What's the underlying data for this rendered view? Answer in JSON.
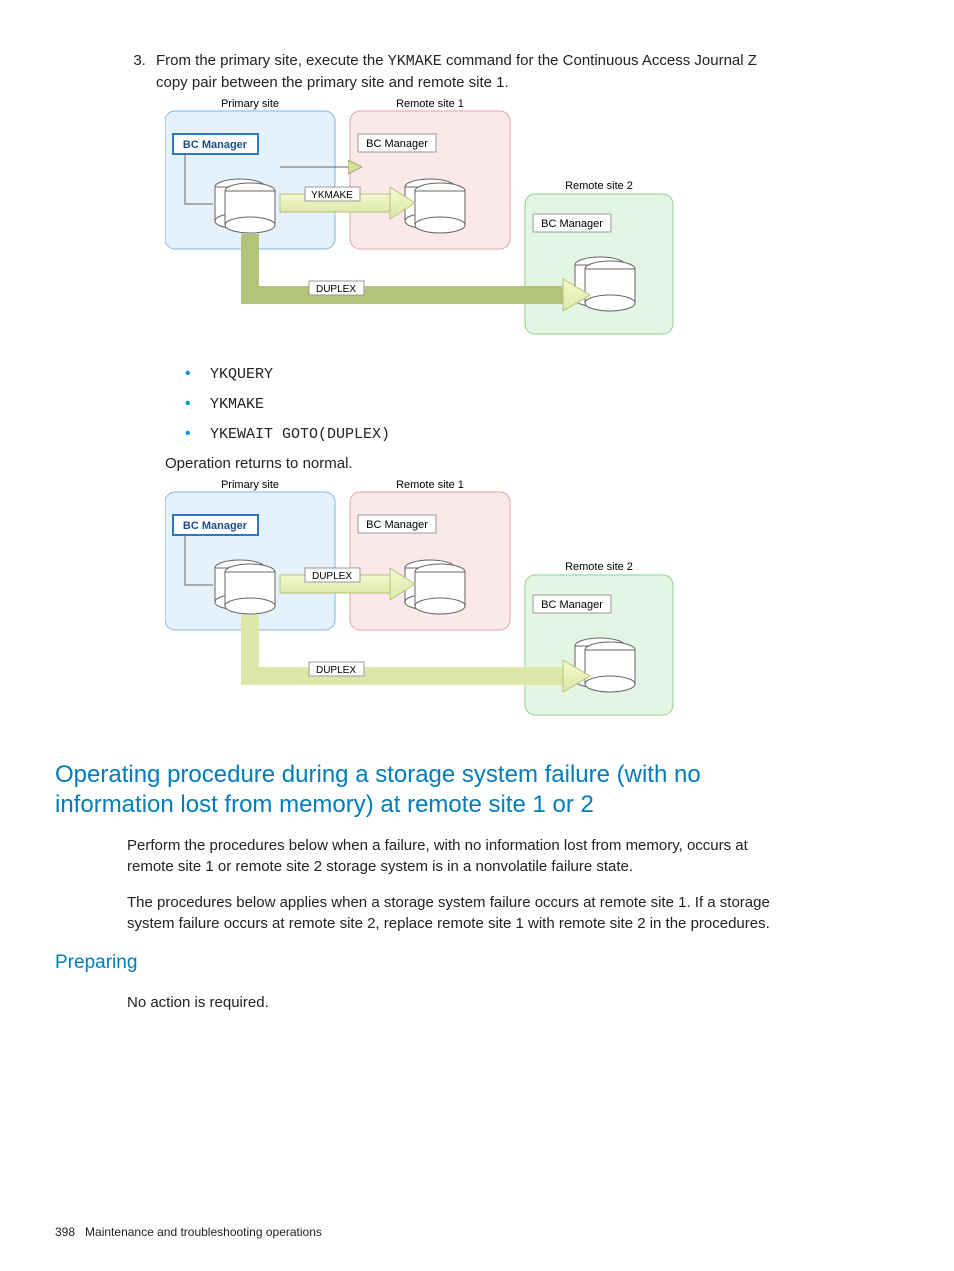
{
  "step3": {
    "number": "3.",
    "prefix": "From the primary site, execute the ",
    "command": "YKMAKE",
    "suffix": " command for the Continuous Access Journal Z copy pair between the primary site and remote site 1."
  },
  "diagram1": {
    "primary_label": "Primary site",
    "remote1_label": "Remote site 1",
    "remote2_label": "Remote site 2",
    "bcm": "BC Manager",
    "arrow1_label": "YKMAKE",
    "arrow2_label": "DUPLEX"
  },
  "commands": {
    "items": [
      "YKQUERY",
      "YKMAKE",
      "YKEWAIT GOTO(DUPLEX)"
    ]
  },
  "return_text": "Operation returns to normal.",
  "diagram2": {
    "primary_label": "Primary site",
    "remote1_label": "Remote site 1",
    "remote2_label": "Remote site 2",
    "bcm": "BC Manager",
    "arrow1_label": "DUPLEX",
    "arrow2_label": "DUPLEX"
  },
  "section_heading": "Operating procedure during a storage system failure (with no information lost from memory) at remote site 1 or 2",
  "section_p1": "Perform the procedures below when a failure, with no information lost from memory, occurs at remote site 1 or remote site 2 storage system is in a nonvolatile failure state.",
  "section_p2": "The procedures below applies when a storage system failure occurs at remote site 1. If a storage system failure occurs at remote site 2, replace remote site 1 with remote site 2 in the procedures.",
  "sub_heading": "Preparing",
  "sub_body": "No action is required.",
  "footer": {
    "page": "398",
    "title": "Maintenance and troubleshooting operations"
  }
}
